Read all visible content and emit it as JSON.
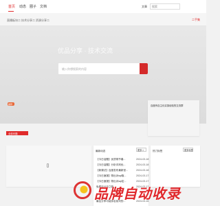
{
  "header": {
    "nav": [
      "首页",
      "动态",
      "圈子",
      "文档"
    ],
    "search_type": "文章",
    "search_value": "搜索",
    "right_link": "二手集"
  },
  "subnav": [
    "直播板块二",
    "技术分享二",
    "资源分享二"
  ],
  "hero": {
    "title": "优品分享 · 技术交流",
    "search_placeholder": "输入你想搜索的内容"
  },
  "badge": "推荐",
  "side_card": {
    "title": "百度有自主化实操经验的交流群"
  },
  "section_label": "全部问题",
  "news": {
    "title": "最新动态",
    "more": "更多 >",
    "items": [
      {
        "title": "【今日话题】优质带节奏...",
        "date": "2024-03-18"
      },
      {
        "title": "【今日话题】分析评判优...",
        "date": "2024-03-18"
      },
      {
        "title": "【新课试】百度发布最新官...",
        "date": "2024-03-18"
      },
      {
        "title": "【今日速报】物出对sql取...",
        "date": "2024-03-17"
      },
      {
        "title": "【今日速报】物出对sql定...",
        "date": "2024-03-17"
      },
      {
        "title": "免费百分百之路",
        "date": "2024-03-17"
      },
      {
        "title": "最佳分享可能排名前列的...",
        "date": "2024-03-16"
      }
    ]
  },
  "right_panel": {
    "title": "热门标签",
    "more": "更多标签"
  },
  "watermark": "品牌自动收录"
}
